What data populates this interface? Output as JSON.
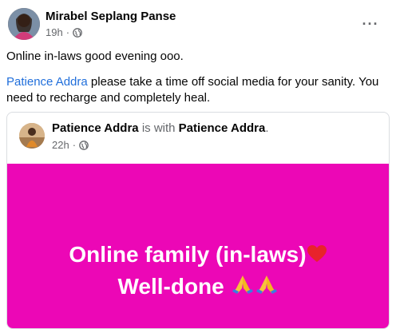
{
  "post": {
    "author": "Mirabel Seplang Panse",
    "time": "19h",
    "separator": "·",
    "privacy_icon": "globe-icon",
    "more_icon": "more-options-icon",
    "line1": "Online in-laws good evening ooo.",
    "mention": "Patience Addra",
    "line2_rest": " please take a time off social media for your sanity. You need to recharge and completely heal."
  },
  "shared_post": {
    "author": "Patience Addra",
    "with_text": " is with ",
    "tagged": "Patience Addra",
    "period": ".",
    "time": "22h",
    "separator": "·",
    "privacy_icon": "globe-icon",
    "background_color": "#ec07b6",
    "headline_line1": "Online family (in-laws)",
    "headline_line2": "Well-done",
    "emoji_1": "heart-icon",
    "emoji_2": "praying-hands-icon"
  },
  "colors": {
    "link": "#216fdb",
    "meta": "#65676b",
    "text": "#050505"
  }
}
